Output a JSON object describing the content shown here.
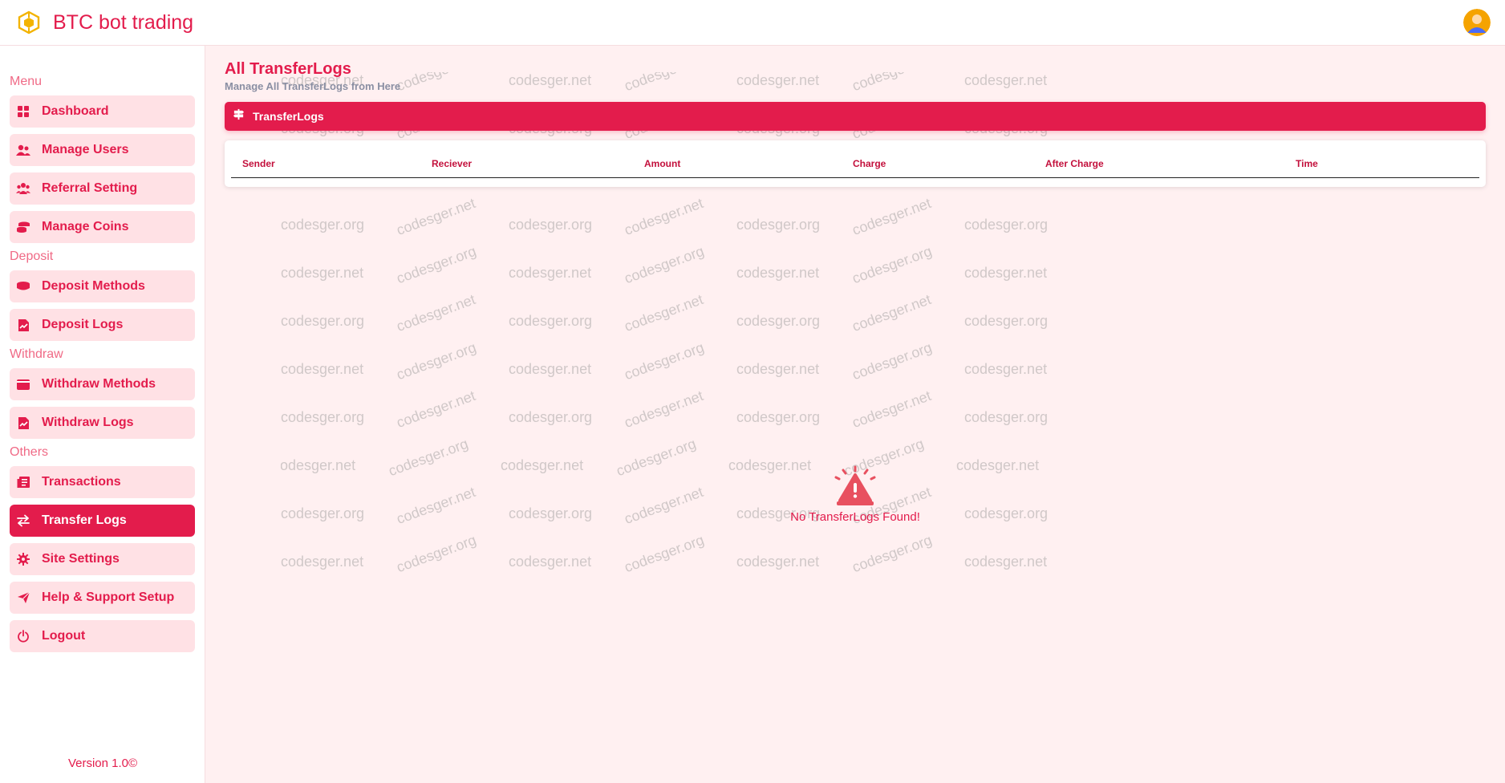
{
  "app": {
    "title": "BTC bot trading",
    "accent_color": "#e31c4c",
    "logo_icon": "cube-logo-icon",
    "avatar_icon": "user-avatar-icon"
  },
  "sidebar": {
    "sections": [
      {
        "label": "Menu",
        "items": [
          {
            "label": "Dashboard",
            "icon": "grid-icon"
          },
          {
            "label": "Manage Users",
            "icon": "users-icon"
          },
          {
            "label": "Referral Setting",
            "icon": "user-group-icon"
          },
          {
            "label": "Manage Coins",
            "icon": "coins-icon"
          }
        ]
      },
      {
        "label": "Deposit",
        "items": [
          {
            "label": "Deposit Methods",
            "icon": "coin-stack-icon"
          },
          {
            "label": "Deposit Logs",
            "icon": "file-chart-icon"
          }
        ]
      },
      {
        "label": "Withdraw",
        "items": [
          {
            "label": "Withdraw Methods",
            "icon": "wallet-icon"
          },
          {
            "label": "Withdraw Logs",
            "icon": "file-chart-icon"
          }
        ]
      },
      {
        "label": "Others",
        "items": [
          {
            "label": "Transactions",
            "icon": "receipt-icon"
          },
          {
            "label": "Transfer Logs",
            "icon": "arrows-exchange-icon",
            "active": true
          },
          {
            "label": "Site Settings",
            "icon": "gear-icon"
          },
          {
            "label": "Help & Support Setup",
            "icon": "paper-plane-icon"
          },
          {
            "label": "Logout",
            "icon": "power-icon"
          }
        ]
      }
    ],
    "version": "Version 1.0©"
  },
  "main": {
    "title": "All TransferLogs",
    "subtitle": "Manage All TransferLogs from Here",
    "bar_label": "TransferLogs",
    "bar_icon": "signpost-icon",
    "table": {
      "columns": [
        "Sender",
        "Reciever",
        "Amount",
        "Charge",
        "After Charge",
        "Time"
      ],
      "rows": []
    },
    "empty": {
      "icon": "alert-siren-icon",
      "text": "No TransferLogs Found!"
    }
  },
  "watermark": {
    "texts": [
      "codesger.net",
      "codesger.org"
    ]
  }
}
